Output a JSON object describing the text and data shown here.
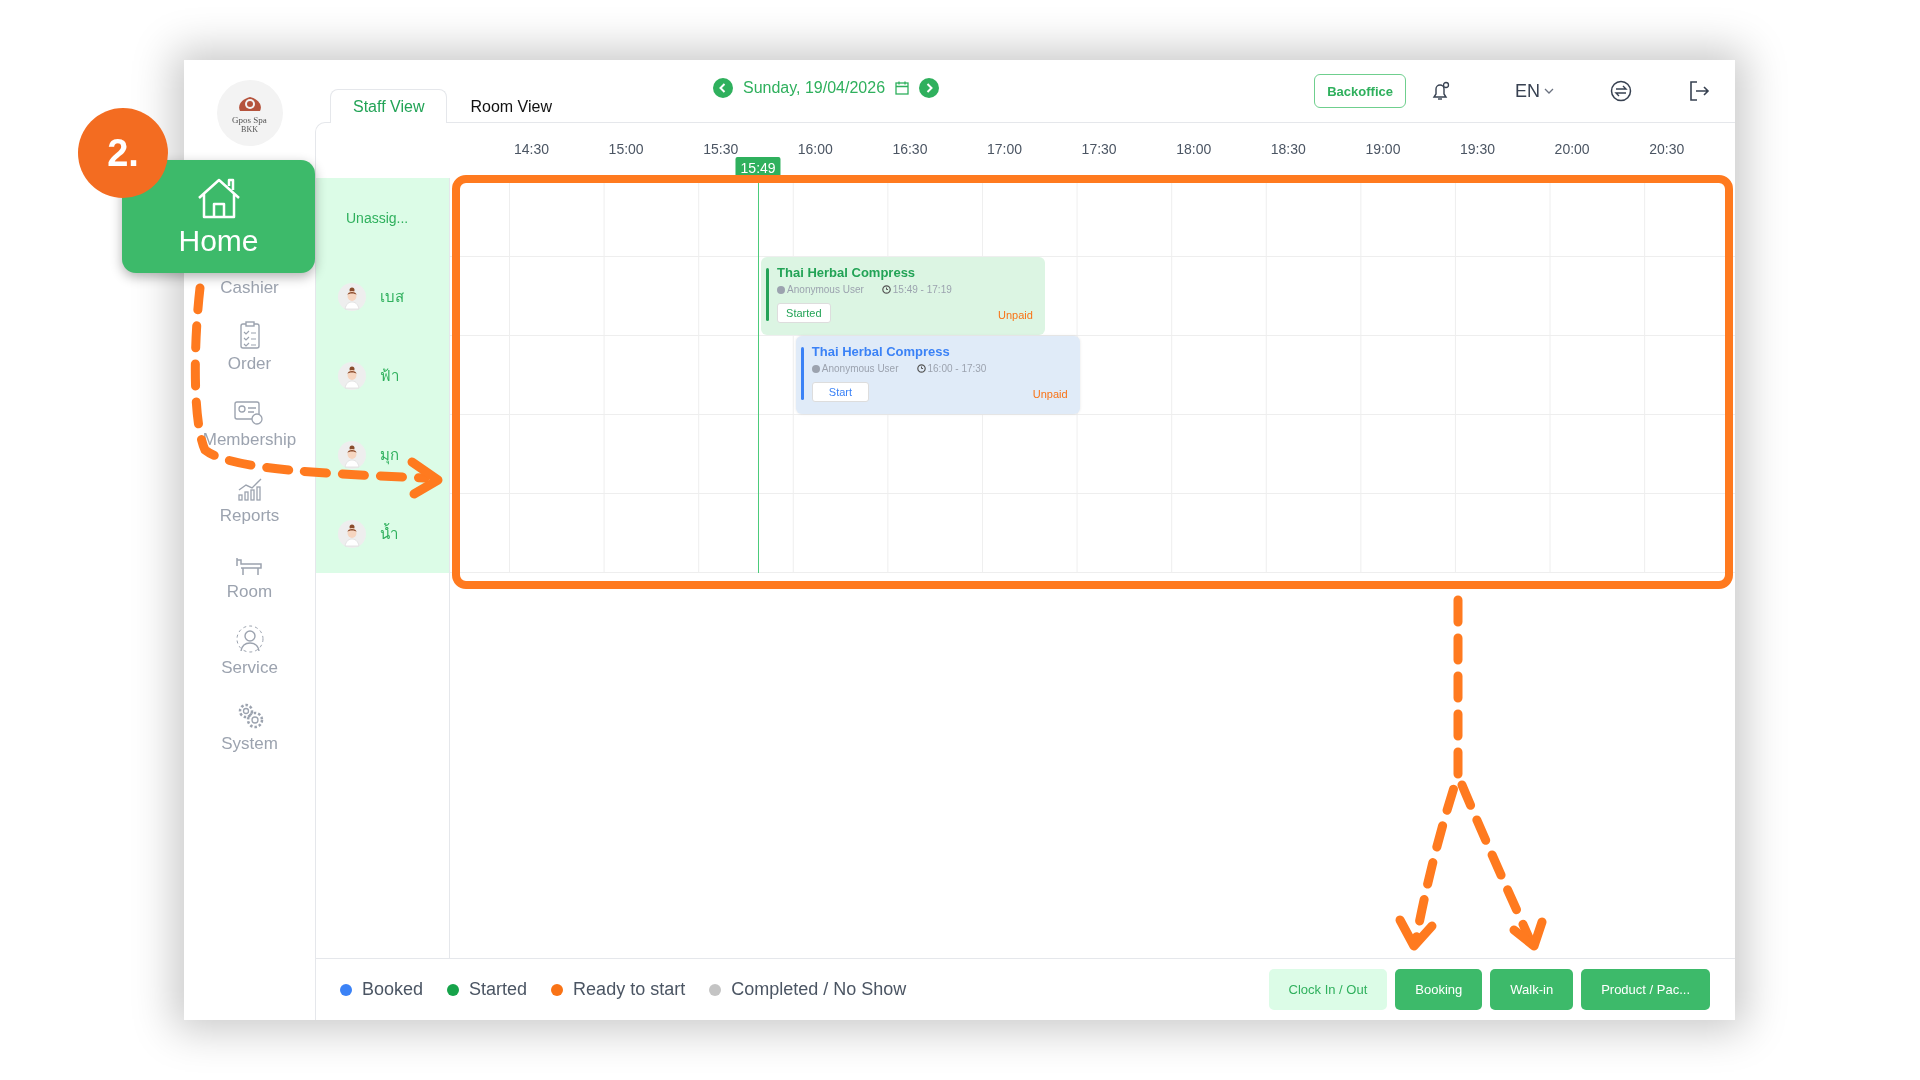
{
  "brand": {
    "name": "Gpos Spa",
    "sub": "BKK"
  },
  "callout": {
    "number": "2.",
    "label": "Home"
  },
  "sidebar": {
    "items": [
      {
        "label": "Cashier",
        "kind": "cashier"
      },
      {
        "label": "Order",
        "kind": "order"
      },
      {
        "label": "Membership",
        "kind": "membership"
      },
      {
        "label": "Reports",
        "kind": "reports"
      },
      {
        "label": "Room",
        "kind": "room"
      },
      {
        "label": "Service",
        "kind": "service"
      },
      {
        "label": "System",
        "kind": "system"
      }
    ]
  },
  "tabs": [
    {
      "label": "Staff View",
      "selected": true
    },
    {
      "label": "Room View",
      "selected": false
    }
  ],
  "date": "Sunday, 19/04/2026",
  "top_actions": {
    "backoffice": "Backoffice",
    "language": "EN"
  },
  "timeline": {
    "times": [
      "14:30",
      "15:00",
      "15:30",
      "16:00",
      "16:30",
      "17:00",
      "17:30",
      "18:00",
      "18:30",
      "19:00",
      "19:30",
      "20:00",
      "20:30"
    ],
    "now": "15:49",
    "unassigned": "Unassig...",
    "staff": [
      {
        "name": "เบส",
        "bookings": [
          {
            "kind": "started",
            "service": "Thai Herbal Compress",
            "customer": "Anonymous User",
            "time": "15:49 - 17:19",
            "action": "Started",
            "payment": "Unpaid"
          }
        ]
      },
      {
        "name": "ฟ้า",
        "bookings": [
          {
            "kind": "booked",
            "service": "Thai Herbal Compress",
            "customer": "Anonymous User",
            "time": "16:00 - 17:30",
            "action": "Start",
            "payment": "Unpaid"
          }
        ]
      },
      {
        "name": "มุก"
      },
      {
        "name": "น้ำ"
      }
    ]
  },
  "legend": [
    {
      "label": "Booked",
      "color": "#3b82f6"
    },
    {
      "label": "Started",
      "color": "#16a34a"
    },
    {
      "label": "Ready to start",
      "color": "#f97316"
    },
    {
      "label": "Completed / No Show",
      "color": "#c4c4c4"
    }
  ],
  "buttons": [
    {
      "label": "Clock In / Out",
      "kind": "light"
    },
    {
      "label": "Booking",
      "kind": "solid"
    },
    {
      "label": "Walk-in",
      "kind": "solid"
    },
    {
      "label": "Product / Pac...",
      "kind": "solid"
    }
  ]
}
